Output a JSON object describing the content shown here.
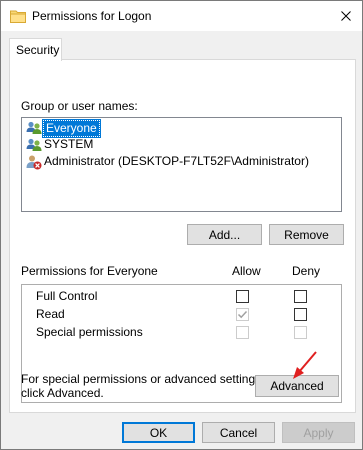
{
  "window": {
    "title": "Permissions for Logon",
    "icons": [
      "folder-icon",
      "close-icon"
    ]
  },
  "tabs": [
    {
      "label": "Security",
      "selected": true
    }
  ],
  "security": {
    "group_label": "Group or user names:",
    "users": [
      {
        "name": "Everyone",
        "icon": "group-icon",
        "selected": true
      },
      {
        "name": "SYSTEM",
        "icon": "group-icon",
        "selected": false
      },
      {
        "name": "Administrator (DESKTOP-F7LT52F\\Administrator)",
        "icon": "user-denied-icon",
        "selected": false
      }
    ],
    "add_button": "Add...",
    "remove_button": "Remove",
    "permissions_header": "Permissions for Everyone",
    "allow_header": "Allow",
    "deny_header": "Deny",
    "permissions": [
      {
        "name": "Full Control",
        "allow": "unchecked",
        "deny": "unchecked"
      },
      {
        "name": "Read",
        "allow": "checked-disabled",
        "deny": "unchecked"
      },
      {
        "name": "Special permissions",
        "allow": "disabled",
        "deny": "disabled"
      }
    ],
    "advanced_note_line1": "For special permissions or advanced settings,",
    "advanced_note_line2": "click Advanced.",
    "advanced_button": "Advanced"
  },
  "footer": {
    "ok": "OK",
    "cancel": "Cancel",
    "apply": "Apply"
  },
  "colors": {
    "selection": "#0078d7",
    "dialog_bg": "#f0f0f0",
    "annotation_arrow": "#e02020"
  }
}
